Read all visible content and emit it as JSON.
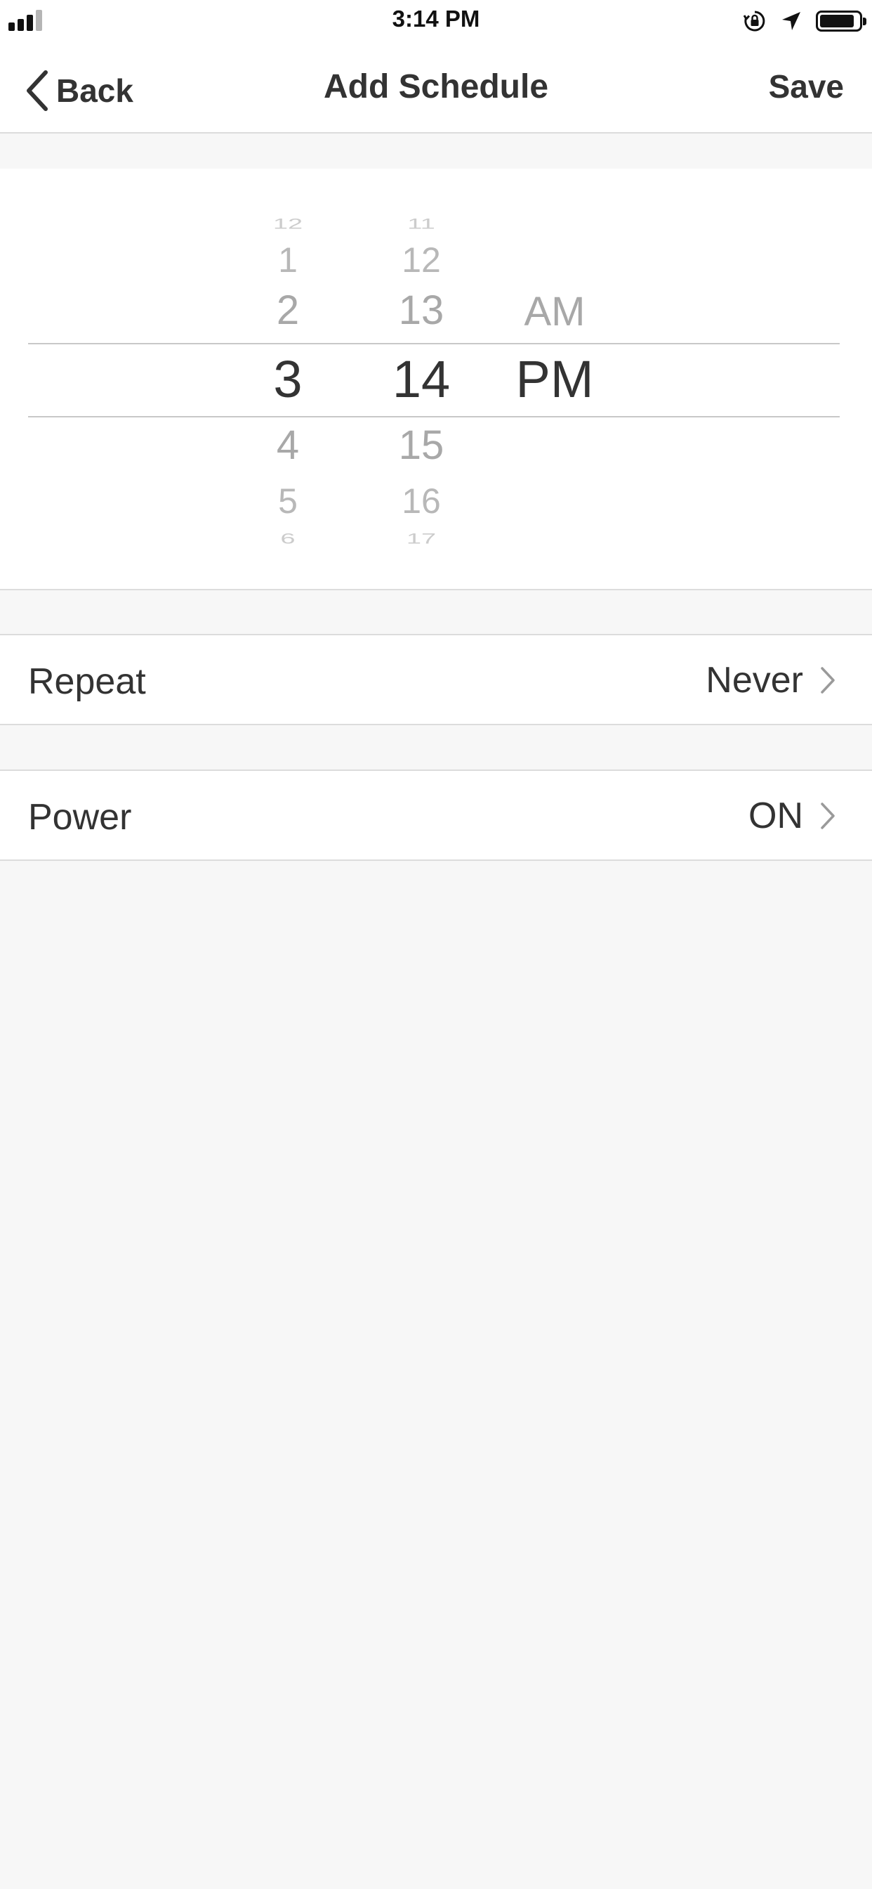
{
  "status_bar": {
    "time": "3:14 PM",
    "icons": [
      "signal-icon",
      "orientation-lock-icon",
      "location-arrow-icon",
      "battery-icon"
    ]
  },
  "nav": {
    "back_label": "Back",
    "title": "Add Schedule",
    "save_label": "Save"
  },
  "picker": {
    "hours": [
      "12",
      "1",
      "2",
      "3",
      "4",
      "5",
      "6"
    ],
    "minutes": [
      "11",
      "12",
      "13",
      "14",
      "15",
      "16",
      "17"
    ],
    "periods": [
      "AM",
      "PM"
    ],
    "selected": {
      "hour": "3",
      "minute": "14",
      "period": "PM"
    }
  },
  "settings": {
    "repeat": {
      "label": "Repeat",
      "value": "Never"
    },
    "power": {
      "label": "Power",
      "value": "ON"
    }
  },
  "colors": {
    "background": "#f7f7f7",
    "surface": "#ffffff",
    "text": "#333333",
    "muted_text": "#b0b0b0",
    "divider": "#dcdcdc"
  }
}
